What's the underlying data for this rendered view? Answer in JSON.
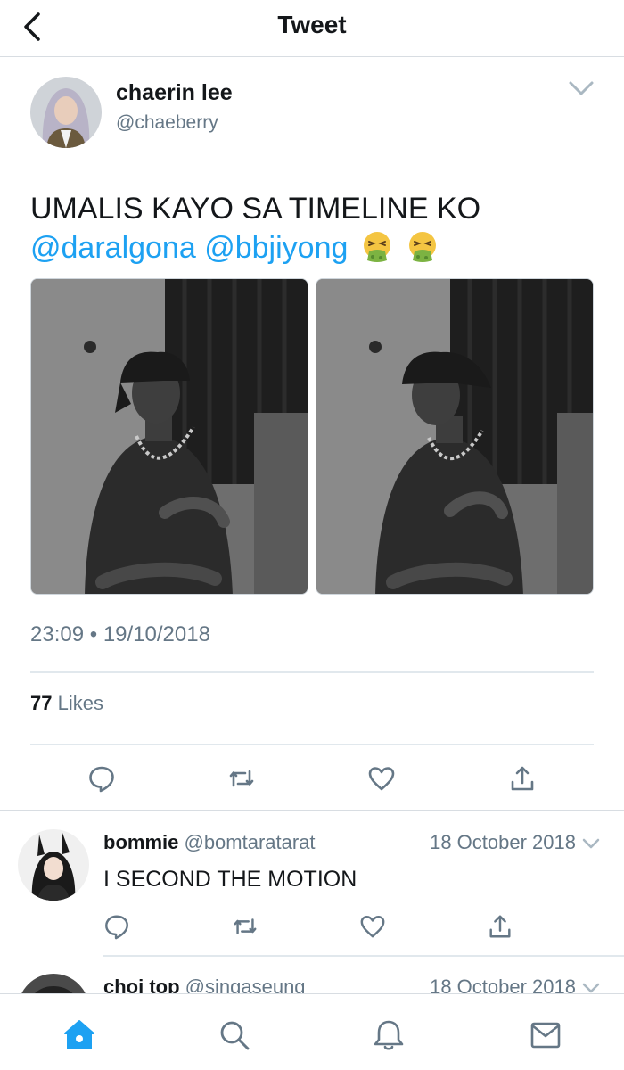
{
  "header": {
    "title": "Tweet",
    "back_icon": "chevron-left-icon"
  },
  "tweet": {
    "author_name": "chaerin lee",
    "author_handle": "@chaeberry",
    "text": "UMALIS KAYO SA TIMELINE KO",
    "mentions": [
      "@daralgona",
      "@bbjiyong"
    ],
    "emojis": [
      "nauseated-face-icon",
      "nauseated-face-icon"
    ],
    "time": "23:09",
    "separator": "•",
    "date": "19/10/2018",
    "likes_count": "77",
    "likes_label": "Likes",
    "actions": [
      "reply-icon",
      "retweet-icon",
      "like-icon",
      "share-icon"
    ]
  },
  "replies": [
    {
      "name": "bommie",
      "handle": "@bomtaratarat",
      "date": "18 October 2018",
      "text": "I SECOND THE MOTION"
    },
    {
      "name": "choi top",
      "handle": "@singaseung",
      "date": "18 October 2018",
      "text": ""
    }
  ],
  "tabbar": {
    "items": [
      "home-icon",
      "search-icon",
      "notifications-icon",
      "messages-icon"
    ],
    "active": "home-icon"
  },
  "colors": {
    "accent": "#1da1f2",
    "text": "#14171a",
    "secondary": "#657786",
    "divider": "#e1e8ed"
  }
}
